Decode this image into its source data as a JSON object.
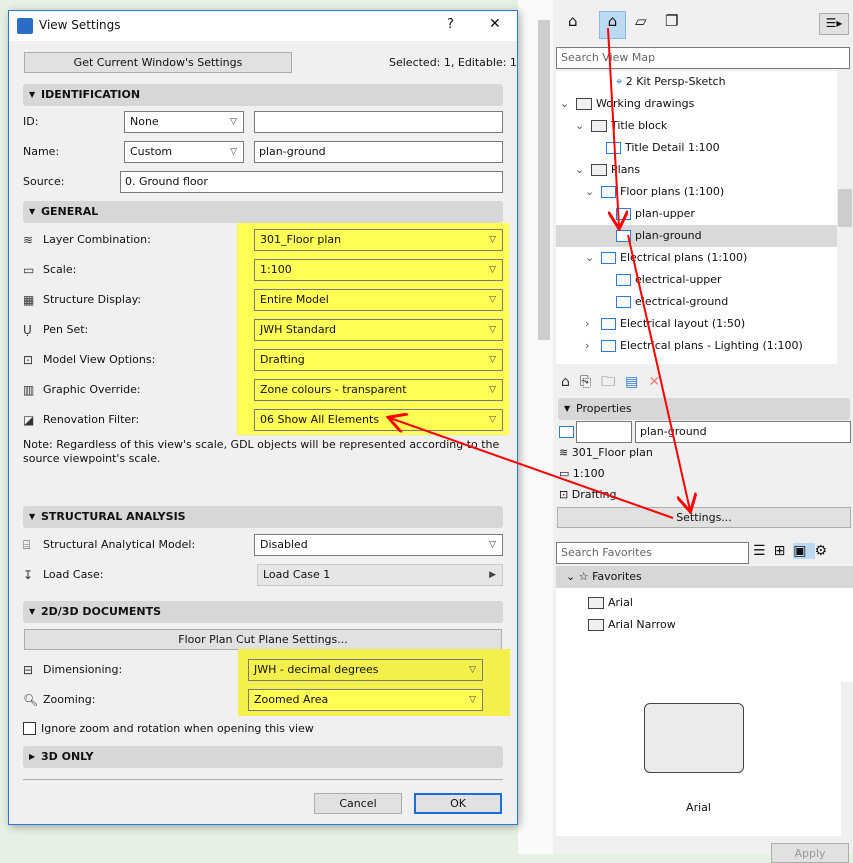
{
  "dialog": {
    "title": "View Settings",
    "help": "?",
    "close": "✕",
    "get_settings": "Get Current Window's Settings",
    "selection_status": "Selected: 1, Editable: 1",
    "identification": {
      "header": "IDENTIFICATION",
      "id_label": "ID:",
      "id_value": "None",
      "id_text": "",
      "name_label": "Name:",
      "name_value": "Custom",
      "name_text": "plan-ground",
      "source_label": "Source:",
      "source_value": "0. Ground floor"
    },
    "general": {
      "header": "GENERAL",
      "rows": [
        {
          "label": "Layer Combination:",
          "value": "301_Floor plan",
          "icon": "layers-icon"
        },
        {
          "label": "Scale:",
          "value": "1:100",
          "icon": "ruler-icon"
        },
        {
          "label": "Structure Display:",
          "value": "Entire Model",
          "icon": "structure-icon"
        },
        {
          "label": "Pen Set:",
          "value": "JWH Standard",
          "icon": "pen-icon"
        },
        {
          "label": "Model View Options:",
          "value": "Drafting",
          "icon": "model-view-icon"
        },
        {
          "label": "Graphic Override:",
          "value": "Zone colours - transparent",
          "icon": "override-icon"
        },
        {
          "label": "Renovation Filter:",
          "value": "06 Show All Elements",
          "icon": "renovation-icon"
        }
      ],
      "note": "Note: Regardless of this view's scale, GDL objects will be represented according to the source viewpoint's scale."
    },
    "structural": {
      "header": "STRUCTURAL ANALYSIS",
      "model_label": "Structural Analytical Model:",
      "model_value": "Disabled",
      "load_label": "Load Case:",
      "load_value": "Load Case 1"
    },
    "docs": {
      "header": "2D/3D DOCUMENTS",
      "cut_plane": "Floor Plan Cut Plane Settings...",
      "dim_label": "Dimensioning:",
      "dim_value": "JWH - decimal degrees",
      "zoom_label": "Zooming:",
      "zoom_value": "Zoomed Area",
      "ignore_label": "Ignore zoom and rotation when opening this view",
      "ignore_checked": false
    },
    "only3d": {
      "header": "3D ONLY"
    },
    "cancel": "Cancel",
    "ok": "OK"
  },
  "navigator": {
    "search_placeholder": "Search View Map",
    "tree": [
      {
        "label": "2 Kit Persp-Sketch",
        "icon": "camera-icon"
      },
      {
        "label": "Working drawings",
        "icon": "folder-icon"
      },
      {
        "label": "Title block",
        "icon": "folder-icon"
      },
      {
        "label": "Title Detail 1:100",
        "icon": "detail-icon"
      },
      {
        "label": "Plans",
        "icon": "folder-icon"
      },
      {
        "label": "Floor plans (1:100)",
        "icon": "clone-folder-icon"
      },
      {
        "label": "plan-upper",
        "icon": "plan-view-icon"
      },
      {
        "label": "plan-ground",
        "icon": "plan-view-icon",
        "selected": true
      },
      {
        "label": "Electrical plans (1:100)",
        "icon": "clone-folder-icon"
      },
      {
        "label": "electrical-upper",
        "icon": "plan-view-icon"
      },
      {
        "label": "electrical-ground",
        "icon": "plan-view-icon"
      },
      {
        "label": "Electrical layout (1:50)",
        "icon": "clone-folder-icon"
      },
      {
        "label": "Electrical plans - Lighting (1:100)",
        "icon": "clone-folder-icon"
      }
    ],
    "properties": {
      "header": "Properties",
      "id": "",
      "name": "plan-ground",
      "layer": "301_Floor plan",
      "scale": "1:100",
      "model_view": "Drafting",
      "settings": "Settings..."
    }
  },
  "favorites": {
    "search_placeholder": "Search Favorites",
    "root": "Favorites",
    "items": [
      "Arial",
      "Arial Narrow"
    ],
    "preview_label": "Arial",
    "apply": "Apply"
  },
  "colors": {
    "highlight": "#ffff55",
    "arrow": "#ff0000",
    "accent": "#2b7bd8"
  }
}
